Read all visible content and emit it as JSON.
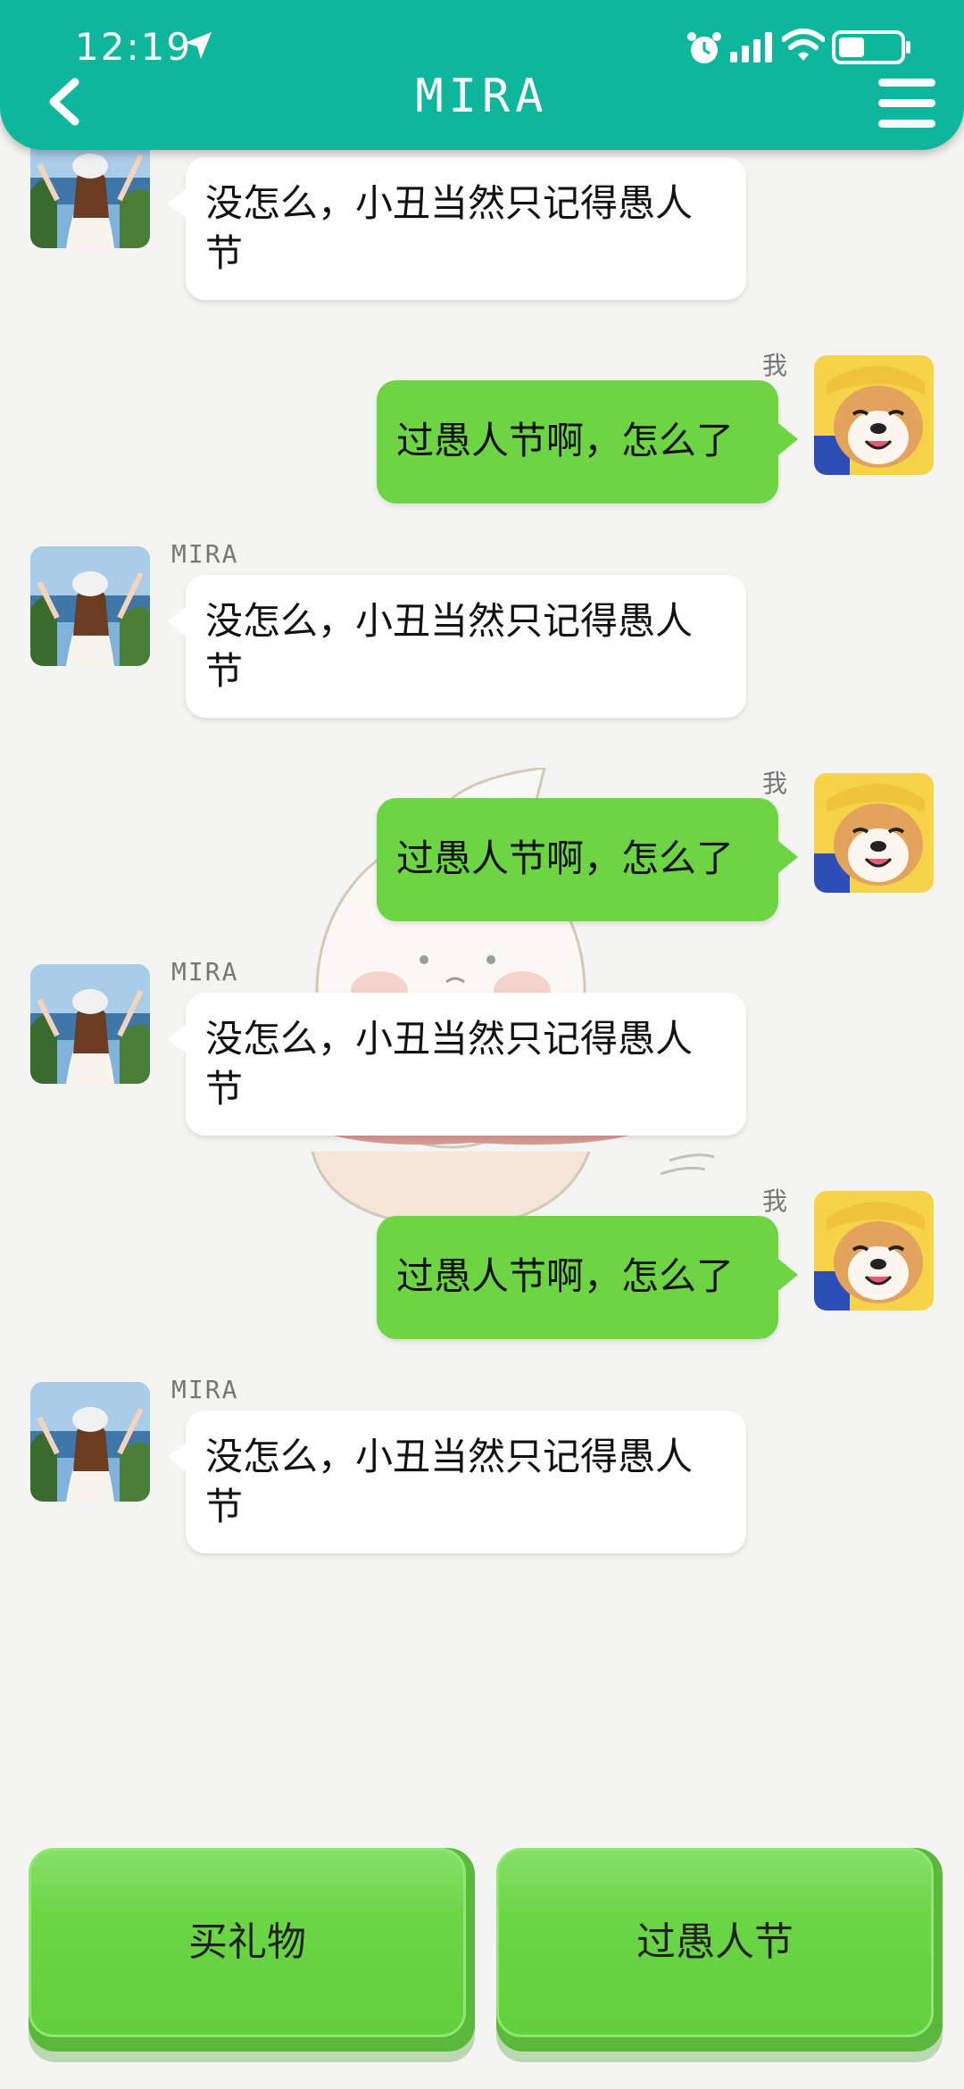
{
  "status_bar": {
    "time": "12:19"
  },
  "header": {
    "title": "MIRA"
  },
  "messages": [
    {
      "side": "in",
      "name": "",
      "text": "没怎么，小丑当然只记得愚人节"
    },
    {
      "side": "out",
      "name": "我",
      "text": "过愚人节啊，怎么了"
    },
    {
      "side": "in",
      "name": "MIRA",
      "text": "没怎么，小丑当然只记得愚人节"
    },
    {
      "side": "out",
      "name": "我",
      "text": "过愚人节啊，怎么了"
    },
    {
      "side": "in",
      "name": "MIRA",
      "text": "没怎么，小丑当然只记得愚人节"
    },
    {
      "side": "out",
      "name": "我",
      "text": "过愚人节啊，怎么了"
    },
    {
      "side": "in",
      "name": "MIRA",
      "text": "没怎么，小丑当然只记得愚人节"
    }
  ],
  "options": [
    {
      "label": "买礼物"
    },
    {
      "label": "过愚人节"
    }
  ],
  "colors": {
    "header": "#0eb79c",
    "bubble_out": "#6dd544",
    "bubble_in": "#ffffff",
    "option": "#6bd646"
  }
}
